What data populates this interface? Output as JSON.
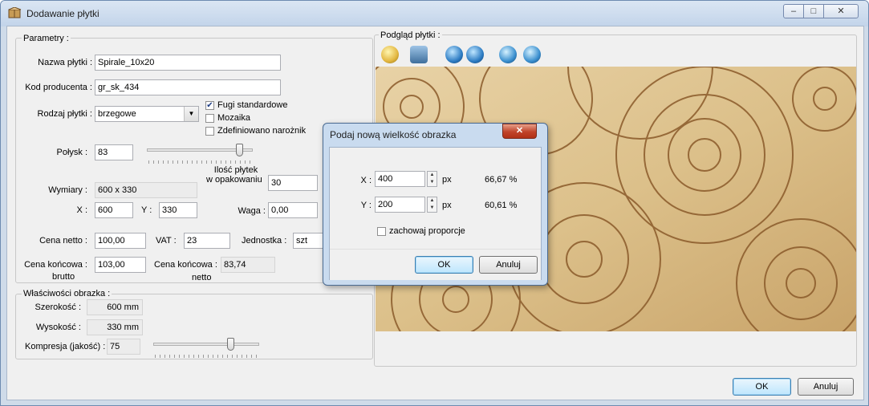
{
  "window": {
    "title": "Dodawanie płytki",
    "app_icon": "tile-icon",
    "minimize": "minimize-icon",
    "maximize": "maximize-icon",
    "close": "close-icon"
  },
  "params": {
    "group_label": "Parametry :",
    "name_label": "Nazwa płytki :",
    "name_value": "Spirale_10x20",
    "code_label": "Kod producenta :",
    "code_value": "gr_sk_434",
    "type_label": "Rodzaj płytki :",
    "type_value": "brzegowe",
    "fugi_label": "Fugi standardowe",
    "fugi_checked": true,
    "mozaika_label": "Mozaika",
    "mozaika_checked": false,
    "corner_label": "Zdefiniowano narożnik",
    "corner_checked": false,
    "gloss_label": "Połysk :",
    "gloss_value": "83",
    "gloss_level": 0.9,
    "dims_label": "Wymiary :",
    "dims_value": "600 x 330",
    "pack_label_1": "Ilość płytek",
    "pack_label_2": "w opakowaniu",
    "pack_value": "30",
    "x_label": "X :",
    "x_value": "600",
    "y_label": "Y :",
    "y_value": "330",
    "weight_label": "Waga :",
    "weight_value": "0,00",
    "net_label": "Cena netto :",
    "net_value": "100,00",
    "vat_label": "VAT :",
    "vat_value": "23",
    "unit_label": "Jednostka :",
    "unit_value": "szt",
    "gross_label_1": "Cena końcowa :",
    "gross_label_2": "brutto",
    "gross_value": "103,00",
    "final_net_label_1": "Cena końcowa :",
    "final_net_label_2": "netto",
    "final_net_value": "83,74"
  },
  "image_props": {
    "group_label": "Właściwości obrazka :",
    "width_label": "Szerokość :",
    "width_value": "600 mm",
    "height_label": "Wysokość :",
    "height_value": "330 mm",
    "compression_label": "Kompresja (jakość) :",
    "compression_value": "75",
    "compression_level": 0.75
  },
  "preview": {
    "group_label": "Podgląd płytki :",
    "toolbar": [
      "open-image-icon",
      "scan-image-icon",
      "resize-icon",
      "crop-icon",
      "rotate-left-icon",
      "rotate-right-icon"
    ]
  },
  "footer": {
    "ok_label": "OK",
    "cancel_label": "Anuluj"
  },
  "dialog": {
    "title": "Podaj nową wielkość obrazka",
    "x_label": "X :",
    "x_value": "400",
    "x_unit": "px",
    "x_percent": "66,67 %",
    "y_label": "Y :",
    "y_value": "200",
    "y_unit": "px",
    "y_percent": "60,61 %",
    "keep_label": "zachowaj proporcje",
    "keep_checked": false,
    "ok_label": "OK",
    "cancel_label": "Anuluj"
  }
}
